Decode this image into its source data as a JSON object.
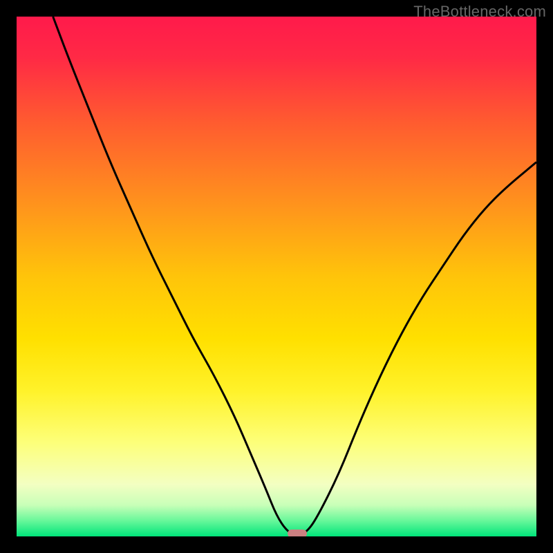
{
  "watermark": "TheBottleneck.com",
  "chart_data": {
    "type": "line",
    "title": "",
    "xlabel": "",
    "ylabel": "",
    "xlim": [
      0,
      100
    ],
    "ylim": [
      0,
      100
    ],
    "grid": false,
    "legend": false,
    "gradient_stops": [
      {
        "offset": 0.0,
        "color": "#ff1a4b"
      },
      {
        "offset": 0.08,
        "color": "#ff2a45"
      },
      {
        "offset": 0.2,
        "color": "#ff5a30"
      },
      {
        "offset": 0.35,
        "color": "#ff8f1e"
      },
      {
        "offset": 0.5,
        "color": "#ffc40a"
      },
      {
        "offset": 0.62,
        "color": "#ffe000"
      },
      {
        "offset": 0.72,
        "color": "#fff22a"
      },
      {
        "offset": 0.82,
        "color": "#fdff7a"
      },
      {
        "offset": 0.9,
        "color": "#f3ffc2"
      },
      {
        "offset": 0.94,
        "color": "#c8ffb8"
      },
      {
        "offset": 0.97,
        "color": "#67f79a"
      },
      {
        "offset": 1.0,
        "color": "#00e57a"
      }
    ],
    "series": [
      {
        "name": "bottleneck-curve",
        "x": [
          7,
          10,
          14,
          18,
          22,
          26,
          30,
          34,
          38,
          42,
          45,
          48,
          50,
          52,
          54,
          56,
          58,
          62,
          66,
          70,
          74,
          78,
          82,
          86,
          90,
          94,
          100
        ],
        "y": [
          100,
          92,
          82,
          72,
          63,
          54,
          46,
          38,
          31,
          23,
          16,
          9,
          4,
          1,
          0,
          1,
          4,
          12,
          22,
          31,
          39,
          46,
          52,
          58,
          63,
          67,
          72
        ]
      }
    ],
    "minimum_point": {
      "x": 54,
      "y": 0
    },
    "marker_color": "#cb8081"
  }
}
